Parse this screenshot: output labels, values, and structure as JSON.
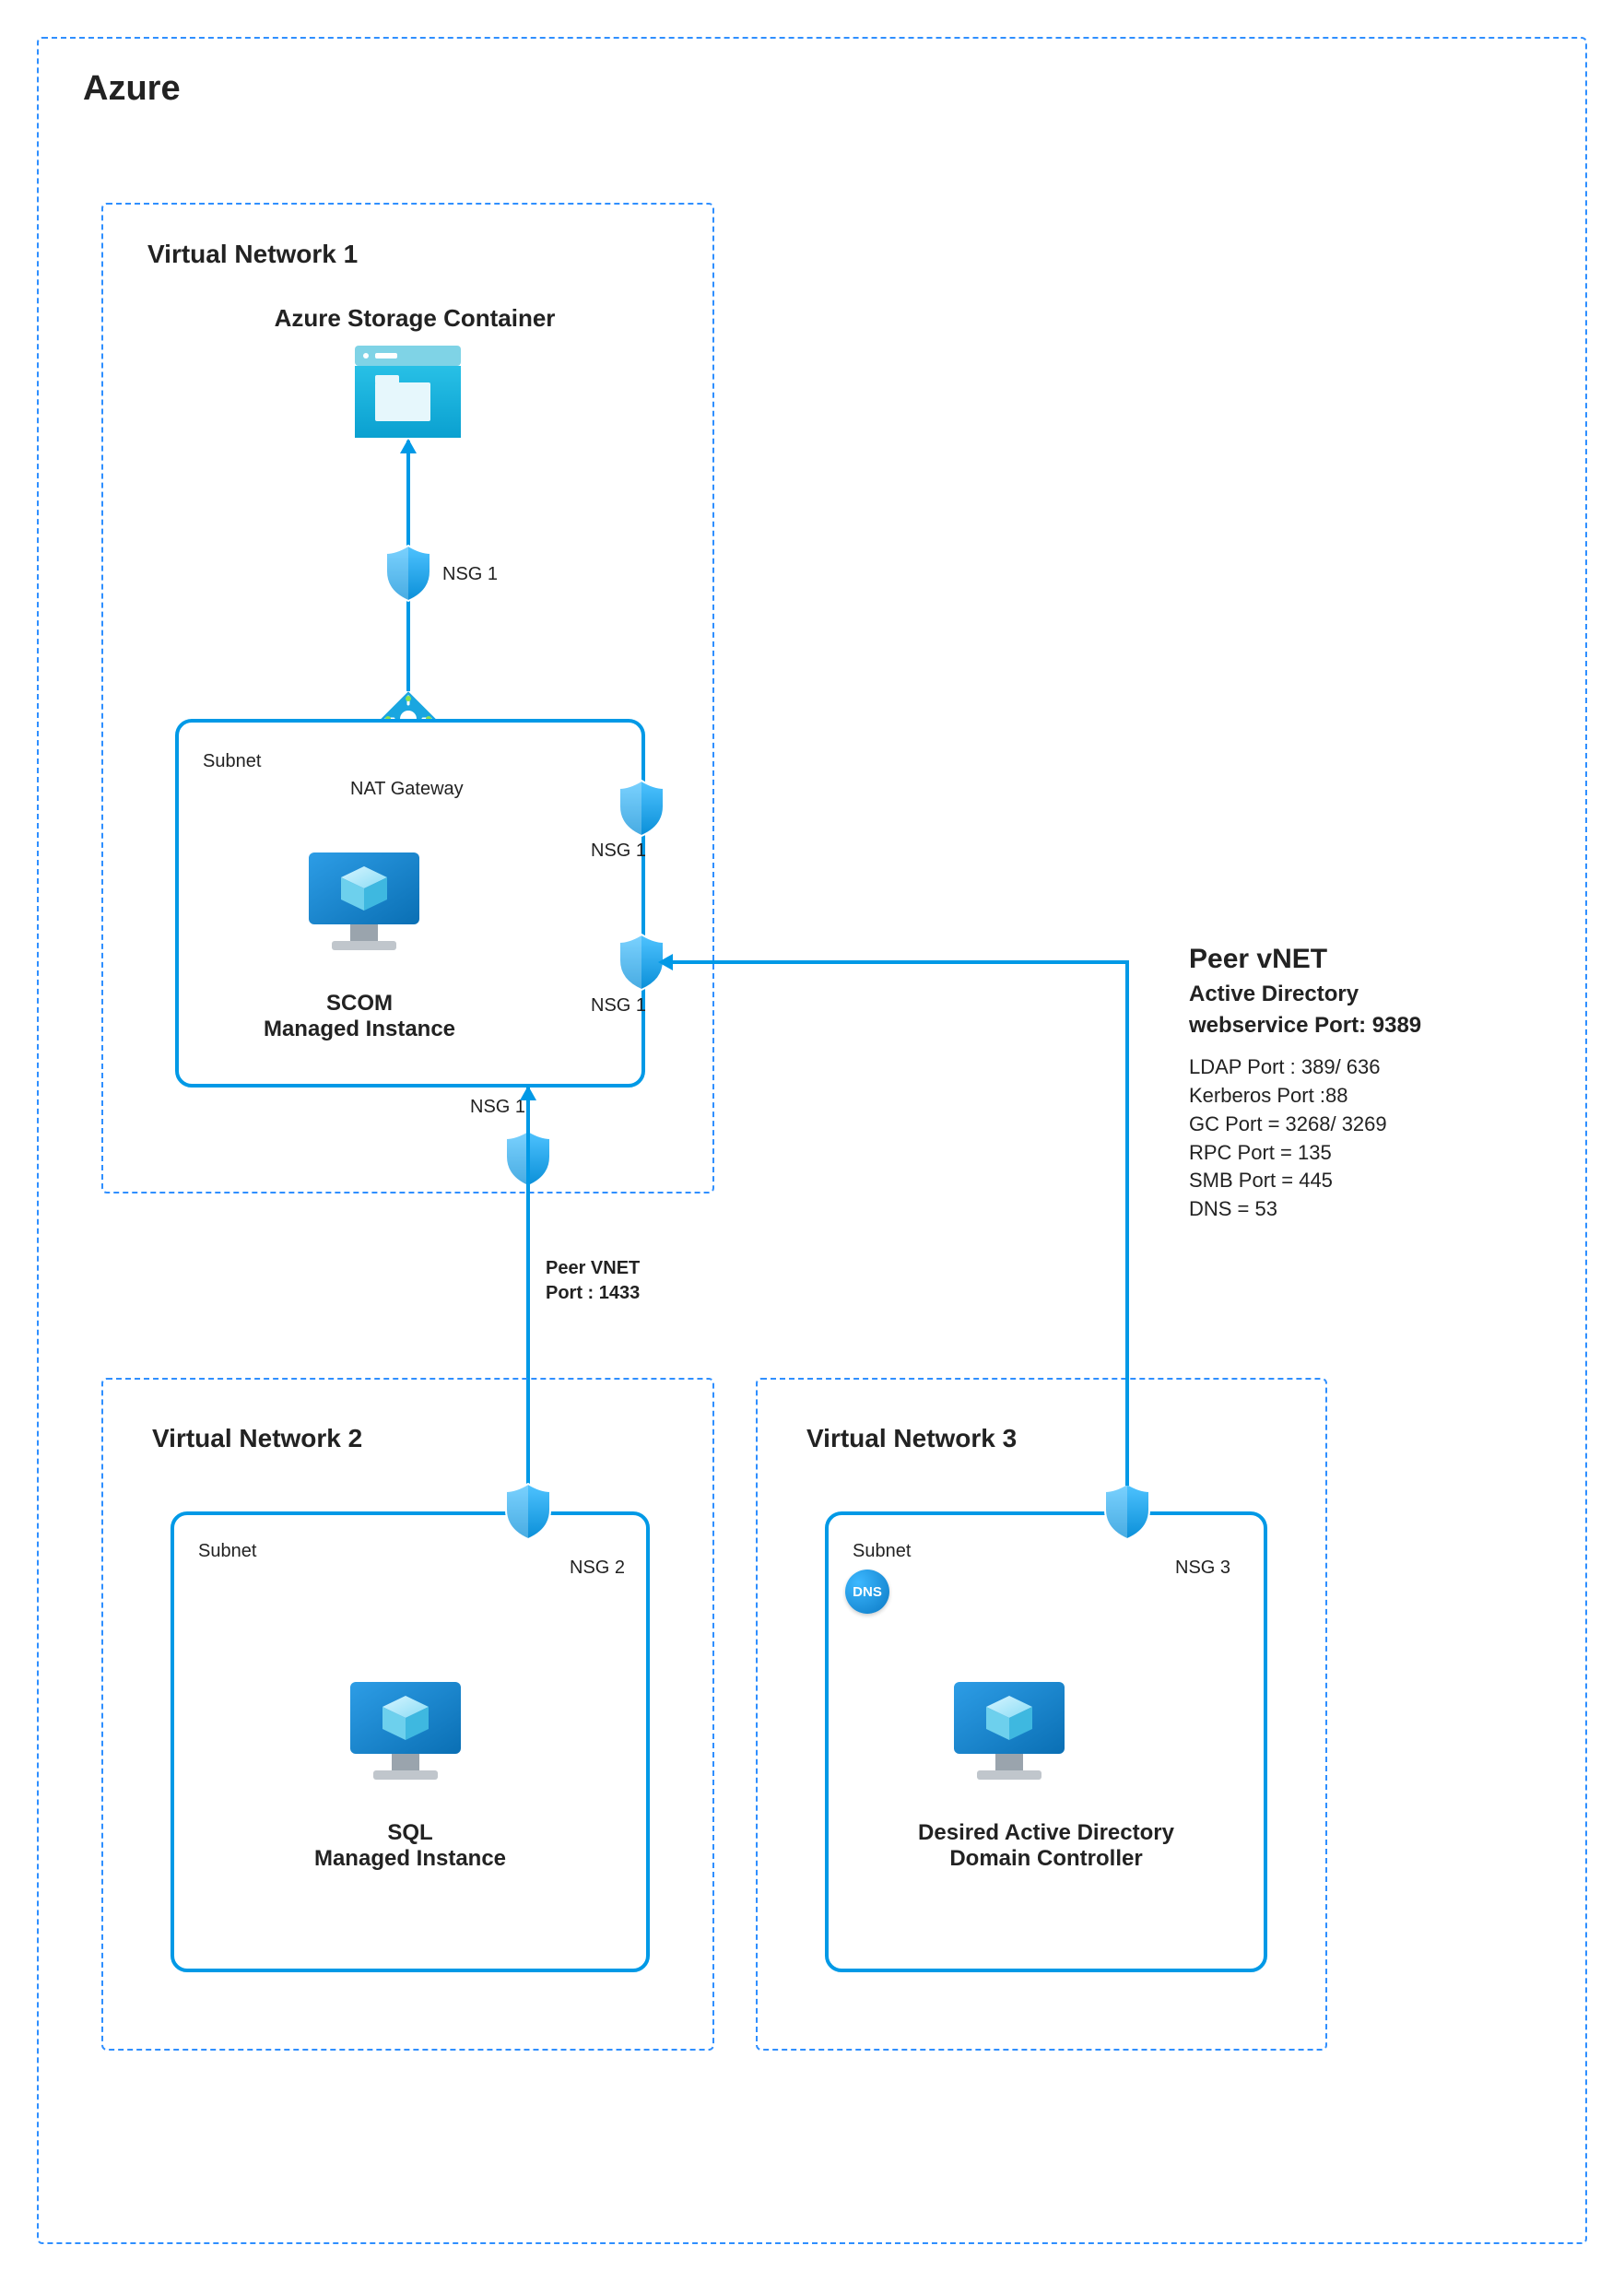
{
  "cloud": {
    "title": "Azure"
  },
  "vnet1": {
    "title": "Virtual Network 1",
    "storage_title": "Azure Storage Container",
    "nat_label": "NAT Gateway",
    "subnet": "Subnet",
    "box_title_1": "SCOM",
    "box_title_2": "Managed Instance",
    "nsg1": "NSG 1",
    "nsg1_right1": "NSG 1",
    "nsg1_right2": "NSG 1",
    "nsg1_bottom": "NSG 1"
  },
  "link12": {
    "line1": "Peer VNET",
    "line2": "Port : 1433"
  },
  "vnet2": {
    "title": "Virtual Network 2",
    "subnet": "Subnet",
    "nsg": "NSG 2",
    "box_title_1": "SQL",
    "box_title_2": "Managed Instance"
  },
  "vnet3": {
    "title": "Virtual Network 3",
    "subnet": "Subnet",
    "nsg": "NSG 3",
    "dns": "DNS",
    "box_title_1": "Desired Active Directory",
    "box_title_2": "Domain Controller"
  },
  "peer": {
    "heading": "Peer vNET",
    "sub1": "Active Directory",
    "sub2": "webservice Port: 9389",
    "lines": [
      "LDAP Port : 389/ 636",
      "Kerberos Port :88",
      "GC Port = 3268/ 3269",
      "RPC Port = 135",
      "SMB Port = 445",
      "DNS = 53"
    ]
  }
}
